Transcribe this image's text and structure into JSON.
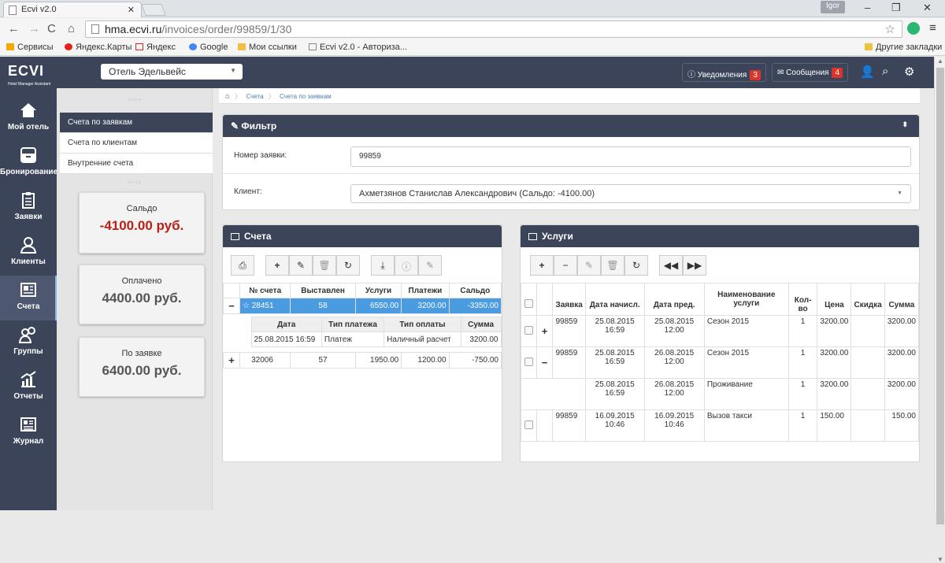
{
  "browser": {
    "tab_title": "Ecvi v2.0",
    "user": "Igor",
    "url_host": "hma.ecvi.ru",
    "url_path": "/invoices/order/99859/1/30",
    "bookmarks": [
      "Сервисы",
      "Яндекс.Карты",
      "Яндекс",
      "Google",
      "Мои ссылки",
      "Ecvi v2.0 - Авториза..."
    ],
    "other_bookmarks": "Другие закладки"
  },
  "header": {
    "logo": "ECVI",
    "logo_sub": "Hotel Manager Assistant",
    "hotel": "Отель Эдельвейс",
    "notifications_label": "Уведомления",
    "notifications_count": "3",
    "messages_label": "Сообщения",
    "messages_count": "4"
  },
  "nav": [
    "Мой отель",
    "Бронирование",
    "Заявки",
    "Клиенты",
    "Счета",
    "Группы",
    "Отчеты",
    "Журнал"
  ],
  "submenu": [
    "Счета по заявкам",
    "Счета по клиентам",
    "Внутренние счета"
  ],
  "cards": [
    {
      "title": "Сальдо",
      "value": "-4100.00 руб."
    },
    {
      "title": "Оплачено",
      "value": "4400.00 руб."
    },
    {
      "title": "По заявке",
      "value": "6400.00 руб."
    }
  ],
  "breadcrumb": [
    "Счета",
    "Счета по заявкам"
  ],
  "filter": {
    "title": "Фильтр",
    "order_label": "Номер заявки:",
    "order_value": "99859",
    "client_label": "Клиент:",
    "client_value": "Ахметзянов Станислав Александрович (Сальдо: -4100.00)"
  },
  "accounts": {
    "title": "Счета",
    "columns": [
      "№ счета",
      "Выставлен",
      "Услуги",
      "Платежи",
      "Сальдо"
    ],
    "rows": [
      {
        "toggle": "−",
        "no": "28451",
        "issued": "58",
        "services": "6550.00",
        "payments": "3200.00",
        "balance": "-3350.00"
      },
      {
        "toggle": "+",
        "no": "32006",
        "issued": "57",
        "services": "1950.00",
        "payments": "1200.00",
        "balance": "-750.00"
      }
    ],
    "payments_columns": [
      "Дата",
      "Тип платежа",
      "Тип оплаты",
      "Сумма"
    ],
    "payments": [
      {
        "date": "25.08.2015 16:59",
        "type": "Платеж",
        "method": "Наличный расчет",
        "sum": "3200.00"
      }
    ]
  },
  "services": {
    "title": "Услуги",
    "columns": [
      "Заявка",
      "Дата начисл.",
      "Дата пред.",
      "Наименование услуги",
      "Кол-во",
      "Цена",
      "Скидка",
      "Сумма"
    ],
    "rows": [
      {
        "toggle": "+",
        "order": "99859",
        "d1": "25.08.2015",
        "t1": "16:59",
        "d2": "25.08.2015",
        "t2": "12:00",
        "name": "Сезон 2015",
        "qty": "1",
        "price": "3200.00",
        "disc": "",
        "sum": "3200.00"
      },
      {
        "toggle": "−",
        "order": "99859",
        "d1": "25.08.2015",
        "t1": "16:59",
        "d2": "26.08.2015",
        "t2": "12:00",
        "name": "Сезон 2015",
        "qty": "1",
        "price": "3200.00",
        "disc": "",
        "sum": "3200.00"
      },
      {
        "toggle": "",
        "order": "",
        "d1": "25.08.2015",
        "t1": "16:59",
        "d2": "26.08.2015",
        "t2": "12:00",
        "name": "Проживание",
        "qty": "1",
        "price": "3200.00",
        "disc": "",
        "sum": "3200.00"
      },
      {
        "toggle": "",
        "order": "99859",
        "d1": "16.09.2015",
        "t1": "10:46",
        "d2": "16.09.2015",
        "t2": "10:46",
        "name": "Вызов такси",
        "qty": "1",
        "price": "150.00",
        "disc": "",
        "sum": "150.00"
      }
    ]
  },
  "colors": {
    "header": "#3b4458",
    "selected_row": "#4a9be0",
    "negative": "#b92119",
    "badge": "#d9352a"
  }
}
